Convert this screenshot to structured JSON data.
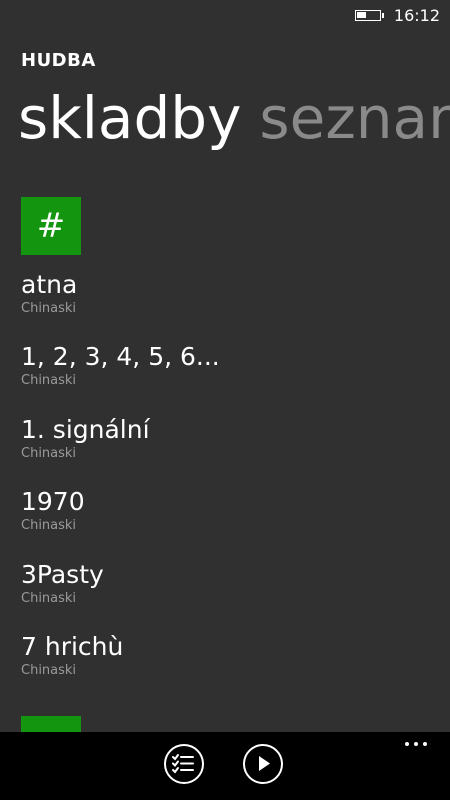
{
  "status_bar": {
    "time": "16:12",
    "battery_level": 0.45
  },
  "header": {
    "app_title": "HUDBA",
    "pivot_tabs": [
      {
        "label": "skladby",
        "active": true
      },
      {
        "label": "seznam",
        "active": false
      }
    ]
  },
  "list": {
    "group_header": "#",
    "songs": [
      {
        "title": "atna",
        "artist": "Chinaski"
      },
      {
        "title": "1, 2, 3, 4, 5, 6...",
        "artist": "Chinaski"
      },
      {
        "title": "1. signální",
        "artist": "Chinaski"
      },
      {
        "title": "1970",
        "artist": "Chinaski"
      },
      {
        "title": "3Pasty",
        "artist": "Chinaski"
      },
      {
        "title": "7 hrichù",
        "artist": "Chinaski"
      }
    ]
  },
  "app_bar": {
    "buttons": [
      {
        "icon": "playlist-icon"
      },
      {
        "icon": "play-icon"
      }
    ],
    "more_icon": "more-dots-icon"
  },
  "colors": {
    "background": "#303030",
    "accent": "#13950f",
    "app_bar": "#000000",
    "secondary_text": "#9a9a9a",
    "inactive_tab": "#8a8a8a"
  }
}
